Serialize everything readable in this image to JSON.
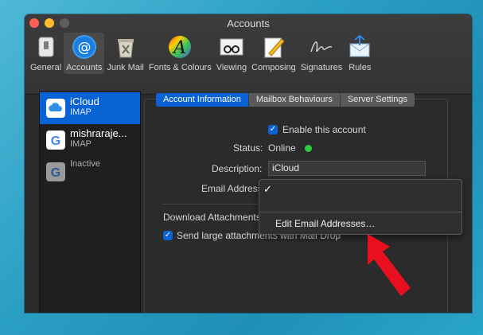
{
  "window": {
    "title": "Accounts"
  },
  "toolbar": {
    "items": [
      {
        "label": "General",
        "icon": "general-switch-icon"
      },
      {
        "label": "Accounts",
        "icon": "at-sign-icon"
      },
      {
        "label": "Junk Mail",
        "icon": "junk-bin-icon"
      },
      {
        "label": "Fonts & Colours",
        "icon": "color-font-icon"
      },
      {
        "label": "Viewing",
        "icon": "glasses-icon"
      },
      {
        "label": "Composing",
        "icon": "pencil-paper-icon"
      },
      {
        "label": "Signatures",
        "icon": "signature-icon"
      },
      {
        "label": "Rules",
        "icon": "rules-envelope-icon"
      }
    ],
    "selected": "Accounts"
  },
  "accounts": [
    {
      "name": "iCloud",
      "type": "IMAP",
      "icon": "icloud-icon"
    },
    {
      "name": "mishraraje...",
      "type": "IMAP",
      "icon": "google-icon"
    },
    {
      "name": "",
      "type": "Inactive",
      "icon": "google-icon"
    }
  ],
  "tabs": [
    "Account Information",
    "Mailbox Behaviours",
    "Server Settings"
  ],
  "form": {
    "enable_label": "Enable this account",
    "status_label": "Status:",
    "status_value": "Online",
    "description_label": "Description:",
    "description_value": "iCloud",
    "email_label": "Email Address",
    "download_label": "Download Attachments",
    "send_large_label": "Send large attachments with Mail Drop"
  },
  "popup": {
    "checkmark": "✓",
    "edit_item": "Edit Email Addresses…"
  },
  "colors": {
    "accent": "#0a63d4",
    "status_online": "#2ecc40",
    "arrow": "#e8101f"
  }
}
